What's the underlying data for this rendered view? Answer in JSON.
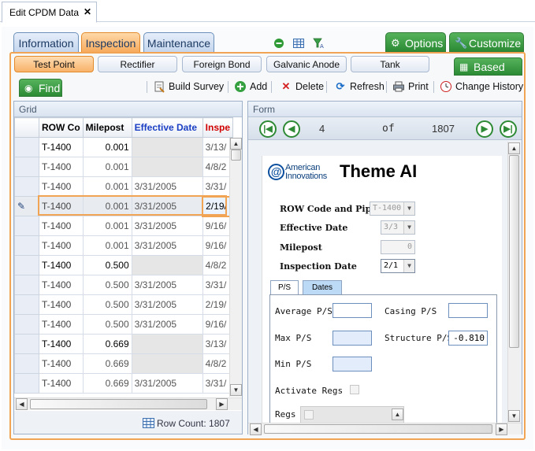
{
  "document_tab": {
    "title": "Edit CPDM Data",
    "close": "✕"
  },
  "top_tabs": [
    "Information",
    "Inspection",
    "Maintenance"
  ],
  "top_right_buttons": {
    "options": "Options",
    "customize": "Customize"
  },
  "sub_tabs": [
    "Test Point",
    "Rectifier",
    "Foreign Bond",
    "Galvanic Anode",
    "Tank"
  ],
  "based_on": "Based On",
  "find": "Find",
  "toolbar": {
    "build_survey": "Build Survey",
    "add": "Add",
    "delete": "Delete",
    "refresh": "Refresh",
    "print": "Print",
    "change_history": "Change History"
  },
  "grid": {
    "title": "Grid",
    "columns": [
      "ROW Co",
      "Milepost",
      "Effective Date",
      "Inspe"
    ],
    "rows": [
      {
        "row": "T-1400",
        "milepost": "0.001",
        "effective": "",
        "inspection": "3/13/",
        "bold": true
      },
      {
        "row": "T-1400",
        "milepost": "0.001",
        "effective": "",
        "inspection": "4/8/2",
        "bold": false
      },
      {
        "row": "T-1400",
        "milepost": "0.001",
        "effective": "3/31/2005",
        "inspection": "3/31/",
        "bold": false
      },
      {
        "row": "T-1400",
        "milepost": "0.001",
        "effective": "3/31/2005",
        "inspection": "2/19/",
        "bold": false,
        "current": true
      },
      {
        "row": "T-1400",
        "milepost": "0.001",
        "effective": "3/31/2005",
        "inspection": "9/16/",
        "bold": false
      },
      {
        "row": "T-1400",
        "milepost": "0.001",
        "effective": "3/31/2005",
        "inspection": "9/16/",
        "bold": false
      },
      {
        "row": "T-1400",
        "milepost": "0.500",
        "effective": "",
        "inspection": "4/8/2",
        "bold": true
      },
      {
        "row": "T-1400",
        "milepost": "0.500",
        "effective": "3/31/2005",
        "inspection": "3/31/",
        "bold": false
      },
      {
        "row": "T-1400",
        "milepost": "0.500",
        "effective": "3/31/2005",
        "inspection": "2/19/",
        "bold": false
      },
      {
        "row": "T-1400",
        "milepost": "0.500",
        "effective": "3/31/2005",
        "inspection": "9/16/",
        "bold": false
      },
      {
        "row": "T-1400",
        "milepost": "0.669",
        "effective": "",
        "inspection": "3/13/",
        "bold": true
      },
      {
        "row": "T-1400",
        "milepost": "0.669",
        "effective": "",
        "inspection": "4/8/2",
        "bold": false
      },
      {
        "row": "T-1400",
        "milepost": "0.669",
        "effective": "3/31/2005",
        "inspection": "3/31/",
        "bold": false
      }
    ],
    "row_count_label": "Row Count:",
    "row_count": "1807"
  },
  "form": {
    "title": "Form",
    "nav": {
      "current": "4",
      "of": "of",
      "total": "1807"
    },
    "logo_text_1": "American",
    "logo_text_2": "Innovations",
    "theme_title": "Theme AI",
    "fields": {
      "row_code_label": "ROW Code and Pipe",
      "row_code_value": "T-1400",
      "effective_date_label": "Effective Date",
      "effective_date_value": "3/3",
      "milepost_label": "Milepost",
      "milepost_value": "0",
      "inspection_date_label": "Inspection Date",
      "inspection_date_value": "2/1"
    },
    "tabs": [
      "P/S",
      "Dates"
    ],
    "ps": {
      "average_label": "Average P/S",
      "casing_label": "Casing P/S",
      "max_label": "Max P/S",
      "structure_label": "Structure P/S",
      "structure_value": "-0.810",
      "min_label": "Min P/S",
      "activate_regs_label": "Activate Regs",
      "regs_label": "Regs"
    }
  },
  "colors": {
    "accent_orange": "#f0a454",
    "green": "#2b8a34",
    "blue_header": "#1a3fc4",
    "red_header": "#d00000"
  }
}
